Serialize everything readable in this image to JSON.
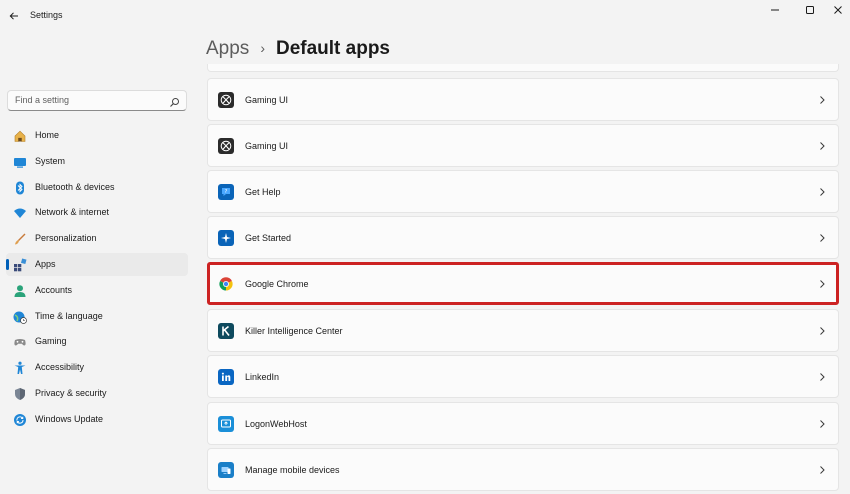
{
  "window": {
    "title": "Settings"
  },
  "breadcrumb": {
    "parent": "Apps",
    "separator": "›",
    "current": "Default apps"
  },
  "search": {
    "placeholder": "Find a setting"
  },
  "sidebar": {
    "items": [
      {
        "label": "Home",
        "icon": "home-icon",
        "selected": false
      },
      {
        "label": "System",
        "icon": "system-icon",
        "selected": false
      },
      {
        "label": "Bluetooth & devices",
        "icon": "bluetooth-icon",
        "selected": false
      },
      {
        "label": "Network & internet",
        "icon": "wifi-icon",
        "selected": false
      },
      {
        "label": "Personalization",
        "icon": "brush-icon",
        "selected": false
      },
      {
        "label": "Apps",
        "icon": "apps-icon",
        "selected": true
      },
      {
        "label": "Accounts",
        "icon": "accounts-icon",
        "selected": false
      },
      {
        "label": "Time & language",
        "icon": "globe-clock-icon",
        "selected": false
      },
      {
        "label": "Gaming",
        "icon": "gamepad-icon",
        "selected": false
      },
      {
        "label": "Accessibility",
        "icon": "accessibility-icon",
        "selected": false
      },
      {
        "label": "Privacy & security",
        "icon": "shield-icon",
        "selected": false
      },
      {
        "label": "Windows Update",
        "icon": "update-icon",
        "selected": false
      }
    ]
  },
  "apps": [
    {
      "label": "Gaming UI",
      "icon": "xbox-icon",
      "highlighted": false
    },
    {
      "label": "Gaming UI",
      "icon": "xbox-icon",
      "highlighted": false
    },
    {
      "label": "Get Help",
      "icon": "get-help-icon",
      "highlighted": false
    },
    {
      "label": "Get Started",
      "icon": "get-started-icon",
      "highlighted": false
    },
    {
      "label": "Google Chrome",
      "icon": "chrome-icon",
      "highlighted": true
    },
    {
      "label": "Killer Intelligence Center",
      "icon": "killer-icon",
      "highlighted": false
    },
    {
      "label": "LinkedIn",
      "icon": "linkedin-icon",
      "highlighted": false
    },
    {
      "label": "LogonWebHost",
      "icon": "logon-web-host-icon",
      "highlighted": false
    },
    {
      "label": "Manage mobile devices",
      "icon": "mobile-devices-icon",
      "highlighted": false
    }
  ],
  "colors": {
    "accent": "#005fb8",
    "highlight_border": "#cc2222",
    "background": "#f3f3f3",
    "card": "#fbfbfb"
  }
}
